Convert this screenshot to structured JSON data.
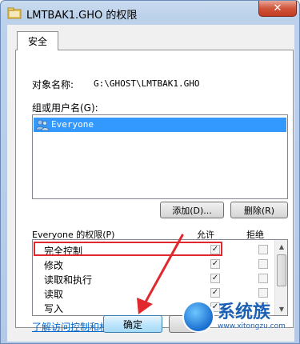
{
  "window": {
    "title": "LMTBAK1.GHO 的权限",
    "close_glyph": "✕"
  },
  "tabs": [
    {
      "label": "安全",
      "active": true
    }
  ],
  "object": {
    "label": "对象名称:",
    "value": "G:\\GHOST\\LMTBAK1.GHO"
  },
  "groups": {
    "label": "组或用户名(G):",
    "items": [
      {
        "name": "Everyone",
        "icon": "users-icon",
        "selected": true
      }
    ],
    "add_button": "添加(D)...",
    "remove_button": "删除(R)"
  },
  "permissions": {
    "title": "Everyone 的权限(P)",
    "allow_header": "允许",
    "deny_header": "拒绝",
    "rows": [
      {
        "name": "完全控制",
        "allow": true,
        "deny": false,
        "highlighted": true
      },
      {
        "name": "修改",
        "allow": true,
        "deny": false
      },
      {
        "name": "读取和执行",
        "allow": true,
        "deny": false
      },
      {
        "name": "读取",
        "allow": true,
        "deny": false
      },
      {
        "name": "写入",
        "allow": true,
        "deny": false
      }
    ]
  },
  "advanced_link": "了解访问控制和权限",
  "footer": {
    "ok_button": "确定"
  },
  "watermark": {
    "text": "系统族",
    "url": "www.xitongzu.com"
  },
  "colors": {
    "selection": "#3399ff",
    "highlight_box": "#e0282e",
    "annotation_arrow": "#e0282e",
    "link": "#0066cc",
    "close_button": "#c23b22"
  }
}
